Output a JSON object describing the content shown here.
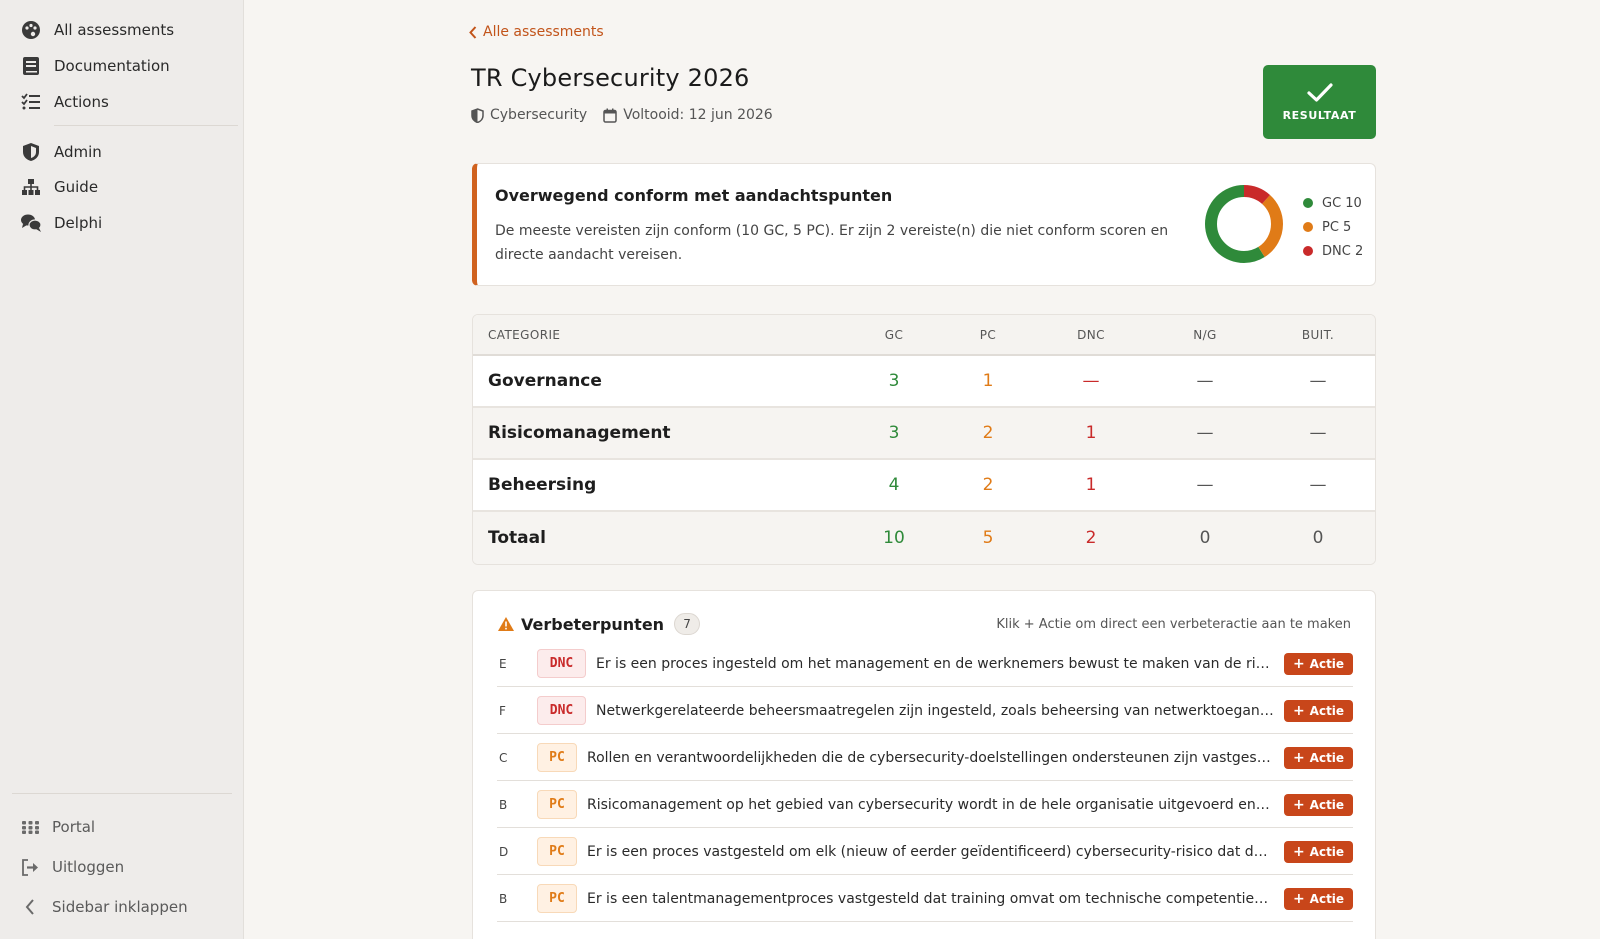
{
  "sidebar": {
    "items": [
      {
        "label": "All assessments",
        "icon": "palette-icon"
      },
      {
        "label": "Documentation",
        "icon": "book-icon"
      },
      {
        "label": "Actions",
        "icon": "checklist-icon"
      },
      {
        "label": "Admin",
        "icon": "shield-icon"
      },
      {
        "label": "Guide",
        "icon": "sitemap-icon"
      },
      {
        "label": "Delphi",
        "icon": "chat-icon"
      }
    ],
    "bottom": [
      {
        "label": "Portal",
        "icon": "grid-icon"
      },
      {
        "label": "Uitloggen",
        "icon": "logout-icon"
      },
      {
        "label": "Sidebar inklappen",
        "icon": "chevron-left-icon"
      }
    ]
  },
  "header": {
    "back_label": "Alle assessments",
    "title": "TR Cybersecurity 2026",
    "category": "Cybersecurity",
    "completed": "Voltooid: 12 jun 2026",
    "result_label": "RESULTAAT"
  },
  "summary": {
    "title": "Overwegend conform met aandachtspunten",
    "description": "De meeste vereisten zijn conform (10 GC, 5 PC). Er zijn 2 vereiste(n) die niet conform scoren en directe aandacht vereisen.",
    "legend": [
      {
        "label": "GC 10",
        "value": 10,
        "color": "#2f8a3a"
      },
      {
        "label": "PC 5",
        "value": 5,
        "color": "#e07b17"
      },
      {
        "label": "DNC 2",
        "value": 2,
        "color": "#c92a2a"
      }
    ]
  },
  "table": {
    "headers": [
      "CATEGORIE",
      "GC",
      "PC",
      "DNC",
      "N/G",
      "BUIT."
    ],
    "rows": [
      {
        "category": "Governance",
        "gc": "3",
        "pc": "1",
        "dnc": "—",
        "ng": "—",
        "buit": "—"
      },
      {
        "category": "Risicomanagement",
        "gc": "3",
        "pc": "2",
        "dnc": "1",
        "ng": "—",
        "buit": "—"
      },
      {
        "category": "Beheersing",
        "gc": "4",
        "pc": "2",
        "dnc": "1",
        "ng": "—",
        "buit": "—"
      }
    ],
    "total": {
      "category": "Totaal",
      "gc": "10",
      "pc": "5",
      "dnc": "2",
      "ng": "0",
      "buit": "0"
    }
  },
  "improvements": {
    "title": "Verbeterpunten",
    "count": "7",
    "hint": "Klik + Actie om direct een verbeteractie aan te maken",
    "action_label": "Actie",
    "items": [
      {
        "letter": "E",
        "badge": "DNC",
        "text": "Er is een proces ingesteld om het management en de werknemers bewust te maken van de risico's en hun verantwoordelijkheden"
      },
      {
        "letter": "F",
        "badge": "DNC",
        "text": "Netwerkgerelateerde beheersmaatregelen zijn ingesteld, zoals beheersing van netwerktoegang en segmentatie"
      },
      {
        "letter": "C",
        "badge": "PC",
        "text": "Rollen en verantwoordelijkheden die de cybersecurity-doelstellingen ondersteunen zijn vastgesteld en gecommuniceerd"
      },
      {
        "letter": "B",
        "badge": "PC",
        "text": "Risicomanagement op het gebied van cybersecurity wordt in de hele organisatie uitgevoerd en gemonitord"
      },
      {
        "letter": "D",
        "badge": "PC",
        "text": "Er is een proces vastgesteld om elk (nieuw of eerder geïdentificeerd) cybersecurity-risico dat de organisatie raakt te beoordelen"
      },
      {
        "letter": "B",
        "badge": "PC",
        "text": "Er is een talentmanagementproces vastgesteld dat training omvat om technische competenties te ontwikkelen"
      }
    ]
  }
}
